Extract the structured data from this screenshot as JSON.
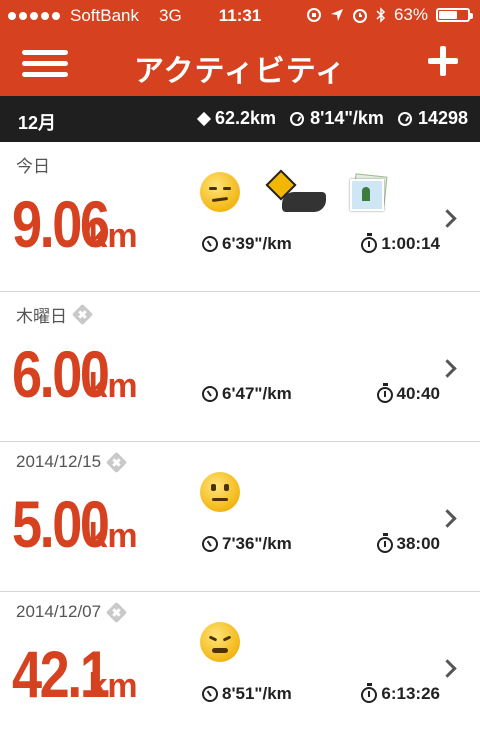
{
  "status_bar": {
    "carrier": "SoftBank",
    "network": "3G",
    "time": "11:31",
    "battery": "63%",
    "battery_level": 0.63
  },
  "nav": {
    "title": "アクティビティ",
    "menu_icon": "hamburger-icon",
    "add_icon": "plus-icon"
  },
  "summary": {
    "month": "12月",
    "distance": "62.2km",
    "pace": "8'14\"/km",
    "steps": "14298"
  },
  "activities": [
    {
      "date": "今日",
      "distance": "9.06",
      "unit": "km",
      "pace": "6'39\"/km",
      "duration": "1:00:14",
      "mood": "meh-face",
      "terrain": "road-icon",
      "photo": "photo-icon"
    },
    {
      "date": "木曜日",
      "distance": "6.00",
      "unit": "km",
      "pace": "6'47\"/km",
      "duration": "40:40"
    },
    {
      "date": "2014/12/15",
      "distance": "5.00",
      "unit": "km",
      "pace": "7'36\"/km",
      "duration": "38:00",
      "mood": "neutral-face"
    },
    {
      "date": "2014/12/07",
      "distance": "42.1",
      "unit": "km",
      "pace": "8'51\"/km",
      "duration": "6:13:26",
      "mood": "tired-face"
    }
  ],
  "colors": {
    "accent": "#d6411f",
    "summary_bg": "#1f1f1f"
  }
}
